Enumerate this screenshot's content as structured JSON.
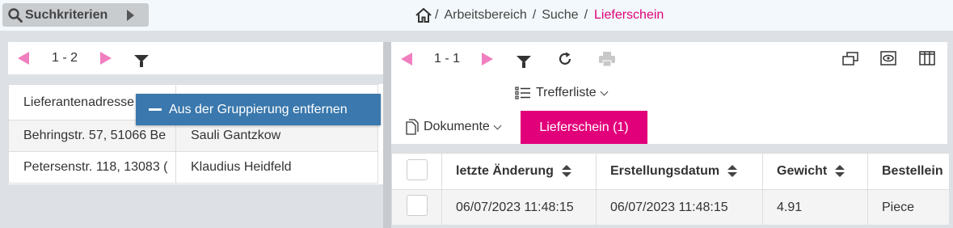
{
  "header": {
    "search_criteria_label": "Suchkriterien",
    "breadcrumb": {
      "separator": "/",
      "items": [
        "Arbeitsbereich",
        "Suche"
      ],
      "current": "Lieferschein"
    }
  },
  "left_panel": {
    "pager_text": "1 - 2",
    "column_headers": [
      "Lieferantenadresse",
      ""
    ],
    "rows": [
      [
        "Behringstr. 57, 51066 Be",
        "Sauli Gantzkow"
      ],
      [
        "Petersenstr. 118, 13083 (",
        "Klaudius Heidfeld"
      ]
    ],
    "tooltip": "Aus der Gruppierung entfernen"
  },
  "right_panel": {
    "pager_text": "1 - 1",
    "view_dropdown": "Trefferliste",
    "documents_dropdown": "Dokumente",
    "active_tab": "Lieferschein (1)",
    "column_headers": [
      "letzte Änderung",
      "Erstellungsdatum",
      "Gewicht",
      "Bestellein"
    ],
    "rows": [
      [
        "06/07/2023 11:48:15",
        "06/07/2023 11:48:15",
        "4.91",
        "Piece"
      ]
    ]
  },
  "colors": {
    "accent": "#e2007a",
    "tooltip": "#3a78ad",
    "pager_arrows": "#f07fc0"
  },
  "icons": [
    "search-icon",
    "chevron-right-icon",
    "home-icon",
    "filter-icon",
    "refresh-icon",
    "print-icon",
    "window-icon",
    "eye-icon",
    "columns-icon",
    "list-icon",
    "document-icon"
  ]
}
